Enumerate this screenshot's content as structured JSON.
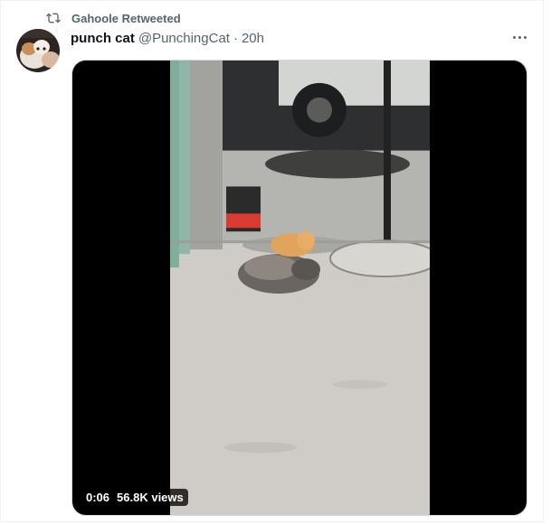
{
  "social_context": {
    "text": "Gahoole Retweeted",
    "icon": "retweet-icon"
  },
  "tweet": {
    "display_name": "punch cat",
    "handle": "@PunchingCat",
    "separator": "·",
    "timestamp": "20h"
  },
  "media": {
    "duration": "0:06",
    "views": "56.8K views"
  },
  "colors": {
    "secondary_text": "#536471",
    "border": "#cfd9de"
  }
}
